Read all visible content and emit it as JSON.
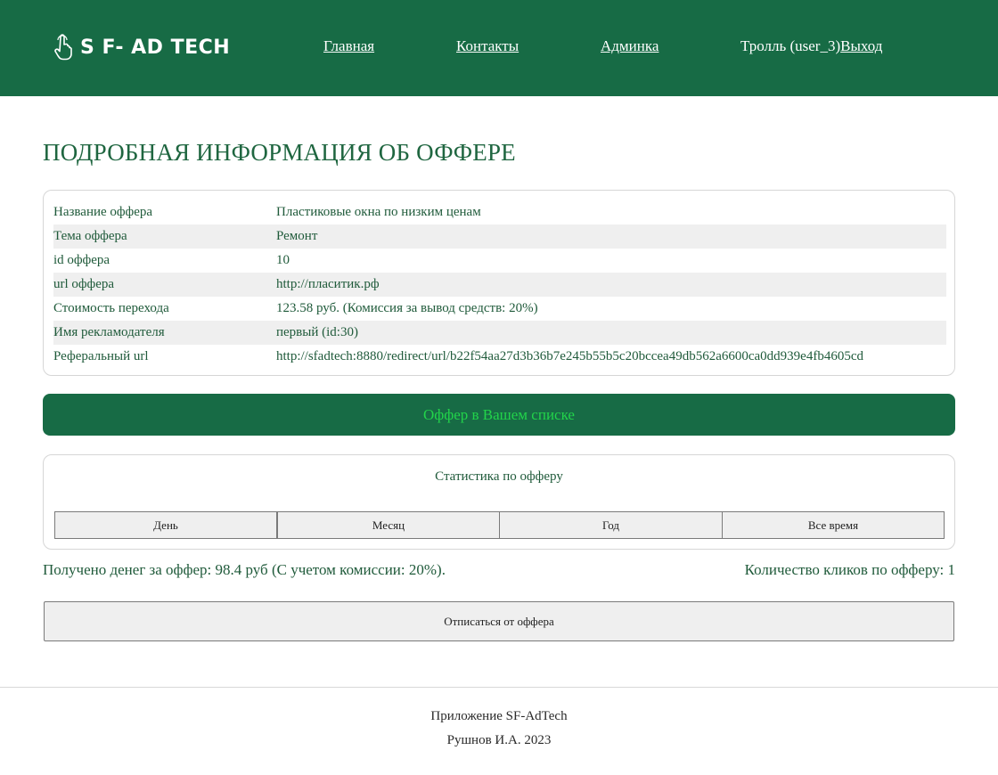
{
  "header": {
    "logo_text": "S F- AD TECH",
    "logo_icon": "pointer-hand-icon",
    "nav": {
      "home": "Главная",
      "contacts": "Контакты",
      "admin": "Админка"
    },
    "user_label": "Тролль (user_3)",
    "logout_label": "Выход"
  },
  "page_title": "ПОДРОБНАЯ ИНФОРМАЦИЯ ОБ ОФФЕРЕ",
  "offer_info": [
    {
      "key": "Название оффера",
      "value": "Пластиковые окна по низким ценам"
    },
    {
      "key": "Тема оффера",
      "value": "Ремонт"
    },
    {
      "key": "id оффера",
      "value": "10"
    },
    {
      "key": "url оффера",
      "value": "http://пласитик.рф"
    },
    {
      "key": "Стоимость перехода",
      "value": "123.58 руб. (Комиссия за вывод средств: 20%)"
    },
    {
      "key": "Имя рекламодателя",
      "value": "первый (id:30)"
    },
    {
      "key": "Реферальный url",
      "value": "http://sfadtech:8880/redirect/url/b22f54aa27d3b36b7e245b55b5c20bccea49db562a6600ca0dd939e4fb4605cd"
    }
  ],
  "status_text": "Оффер в Вашем списке",
  "stats": {
    "title": "Статистика по офферу",
    "periods": [
      "День",
      "Месяц",
      "Год",
      "Все время"
    ]
  },
  "money_text": "Получено денег за оффер: 98.4 руб (С учетом комиссии: 20%).",
  "clicks_text": "Количество кликов по офферу: 1",
  "unsubscribe_label": "Отписаться от оффера",
  "footer": {
    "line1": "Приложение SF-AdTech",
    "line2": "Рушнов И.А. 2023"
  },
  "colors": {
    "brand_green": "#176b45",
    "status_text_green": "#22d44a",
    "text_green": "#1f5a3a"
  }
}
